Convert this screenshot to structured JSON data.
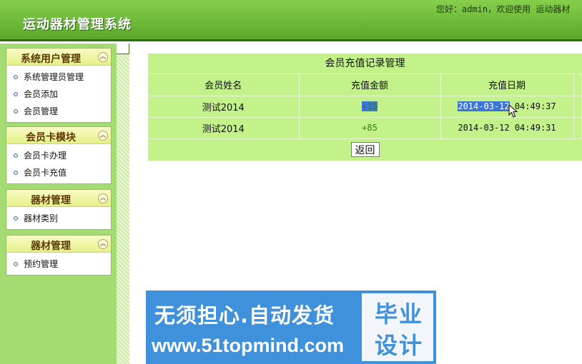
{
  "header": {
    "title": "运动器材管理系统",
    "greeting": "您好：admin，欢迎使用 运动器材"
  },
  "sidebar": {
    "sections": [
      {
        "title": "系统用户管理",
        "items": [
          "系统管理员管理",
          "会员添加",
          "会员管理"
        ]
      },
      {
        "title": "会员卡模块",
        "items": [
          "会员卡办理",
          "会员卡充值"
        ]
      },
      {
        "title": "器材管理",
        "items": [
          "器材类别"
        ]
      },
      {
        "title": "器材管理",
        "items": [
          "预约管理"
        ]
      }
    ],
    "toggle_icon": "double-chevron-up-icon"
  },
  "main": {
    "caption": "会员充值记录管理",
    "columns": [
      "会员姓名",
      "充值金额",
      "充值日期"
    ],
    "rows": [
      {
        "name": "测试2014",
        "amount": "+15",
        "date_sel": "2014-03-12",
        "date_rest": " 04:49:37"
      },
      {
        "name": "测试2014",
        "amount": "+85",
        "date": "2014-03-12 04:49:31"
      }
    ],
    "back_label": "返回"
  },
  "ad": {
    "line1": "无须担心.自动发货",
    "line2": "www.51topmind.com",
    "side1": "毕业",
    "side2": "设计"
  },
  "colors": {
    "header": "#5aa82a",
    "sidebar": "#a4db72",
    "table": "#c2f289",
    "selection": "#3a76d6",
    "ad": "#3f91dc"
  }
}
